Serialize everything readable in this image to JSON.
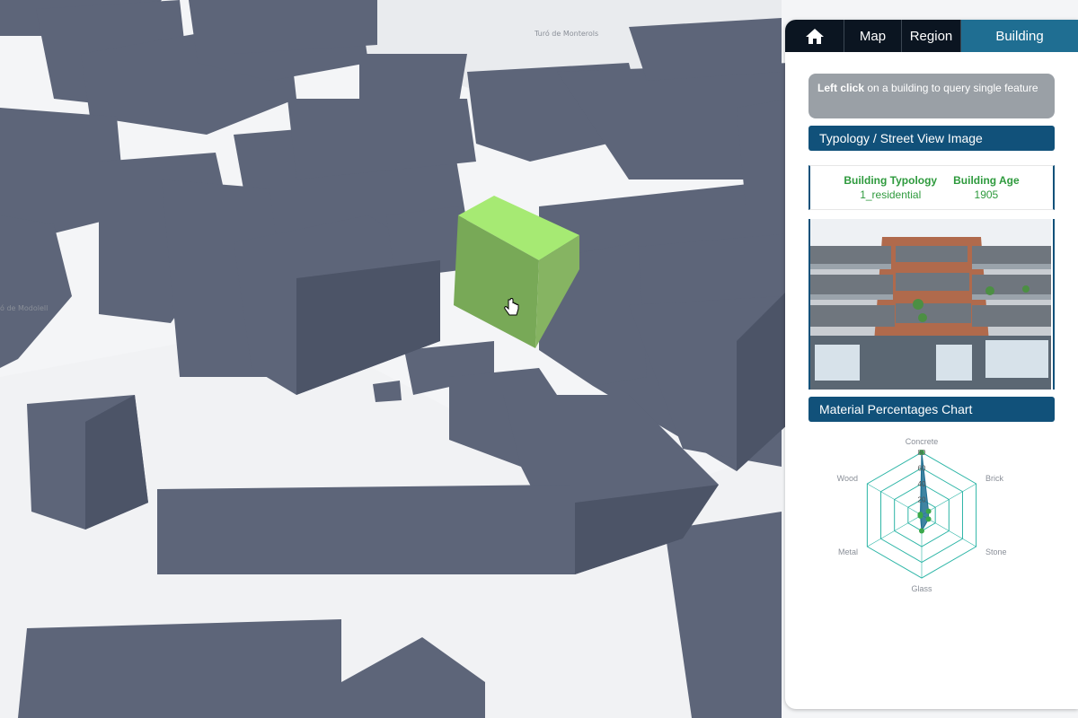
{
  "map": {
    "labels": [
      "Turó de Monterols",
      "ó de Modolell"
    ],
    "colors": {
      "background": "#f4f5f7",
      "building": "#5d6579",
      "selected": "#8fd66a"
    }
  },
  "panel": {
    "tabs": {
      "home_icon": "home-icon",
      "map": "Map",
      "region": "Region",
      "building": "Building"
    },
    "hint": {
      "bold": "Left click",
      "rest": " on a building to query single feature"
    },
    "section_typology": "Typology / Street View Image",
    "typology": {
      "label": "Building Typology",
      "value": "1_residential"
    },
    "age": {
      "label": "Building Age",
      "value": "1905"
    },
    "section_materials": "Material Percentages Chart",
    "colors": {
      "header": "#11517a",
      "active_tab": "#1f6e92",
      "highlight_text": "#2e9a3d"
    }
  },
  "chart_data": {
    "type": "radar",
    "axes": [
      "Concrete",
      "Brick",
      "Stone",
      "Glass",
      "Metal",
      "Wood"
    ],
    "values": [
      80,
      10,
      10,
      20,
      0,
      0
    ],
    "rlim": [
      0,
      80
    ],
    "ticks": [
      "80",
      "60",
      "40",
      "20",
      "0"
    ],
    "colors": {
      "grid": "#2bb5a6",
      "fill": "#1f6e92",
      "points": "#3aa84a"
    }
  }
}
